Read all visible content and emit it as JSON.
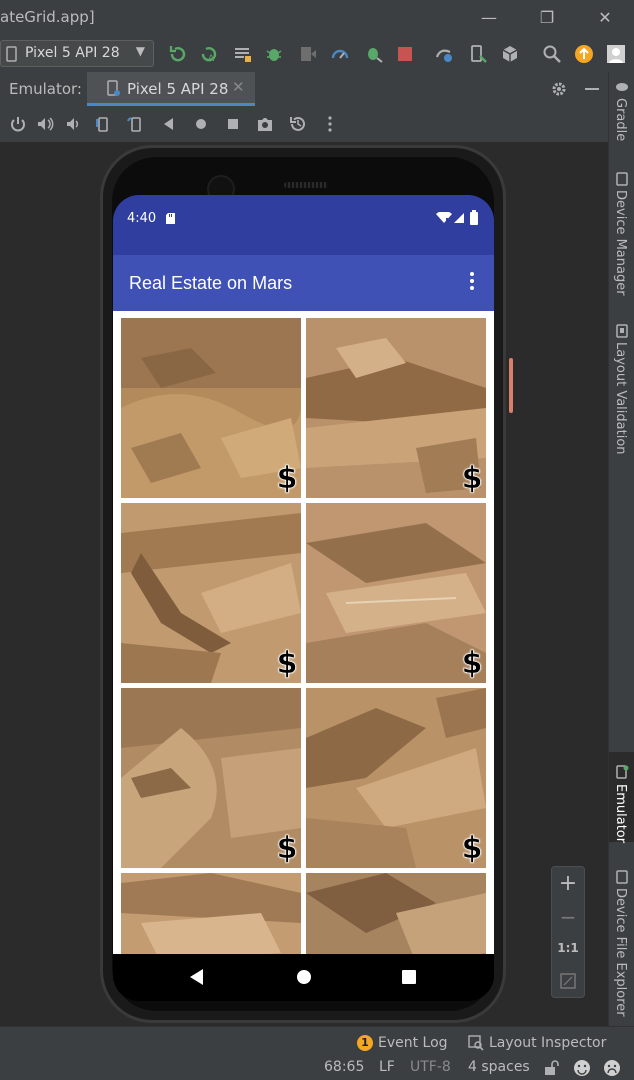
{
  "window": {
    "title": "ateGrid.app]"
  },
  "toolbar": {
    "device_label": "Pixel 5 API 28"
  },
  "emulator": {
    "label": "Emulator:",
    "tab_label": "Pixel 5 API 28"
  },
  "side_tabs": {
    "gradle": "Gradle",
    "device_manager": "Device Manager",
    "layout_validation": "Layout Validation",
    "emulator": "Emulator",
    "device_file_explorer": "Device File Explorer"
  },
  "phone": {
    "time": "4:40",
    "app_title": "Real Estate on Mars",
    "price_symbol": "$",
    "colors": {
      "status_bar": "#303f9f",
      "app_bar": "#3f51b5"
    }
  },
  "zoom": {
    "plus": "+",
    "minus": "−",
    "ratio": "1:1"
  },
  "bottom": {
    "event_log_count": "1",
    "event_log": "Event Log",
    "layout_inspector": "Layout Inspector"
  },
  "status": {
    "position": "68:65",
    "line_sep": "LF",
    "encoding": "UTF-8",
    "indent": "4 spaces"
  }
}
